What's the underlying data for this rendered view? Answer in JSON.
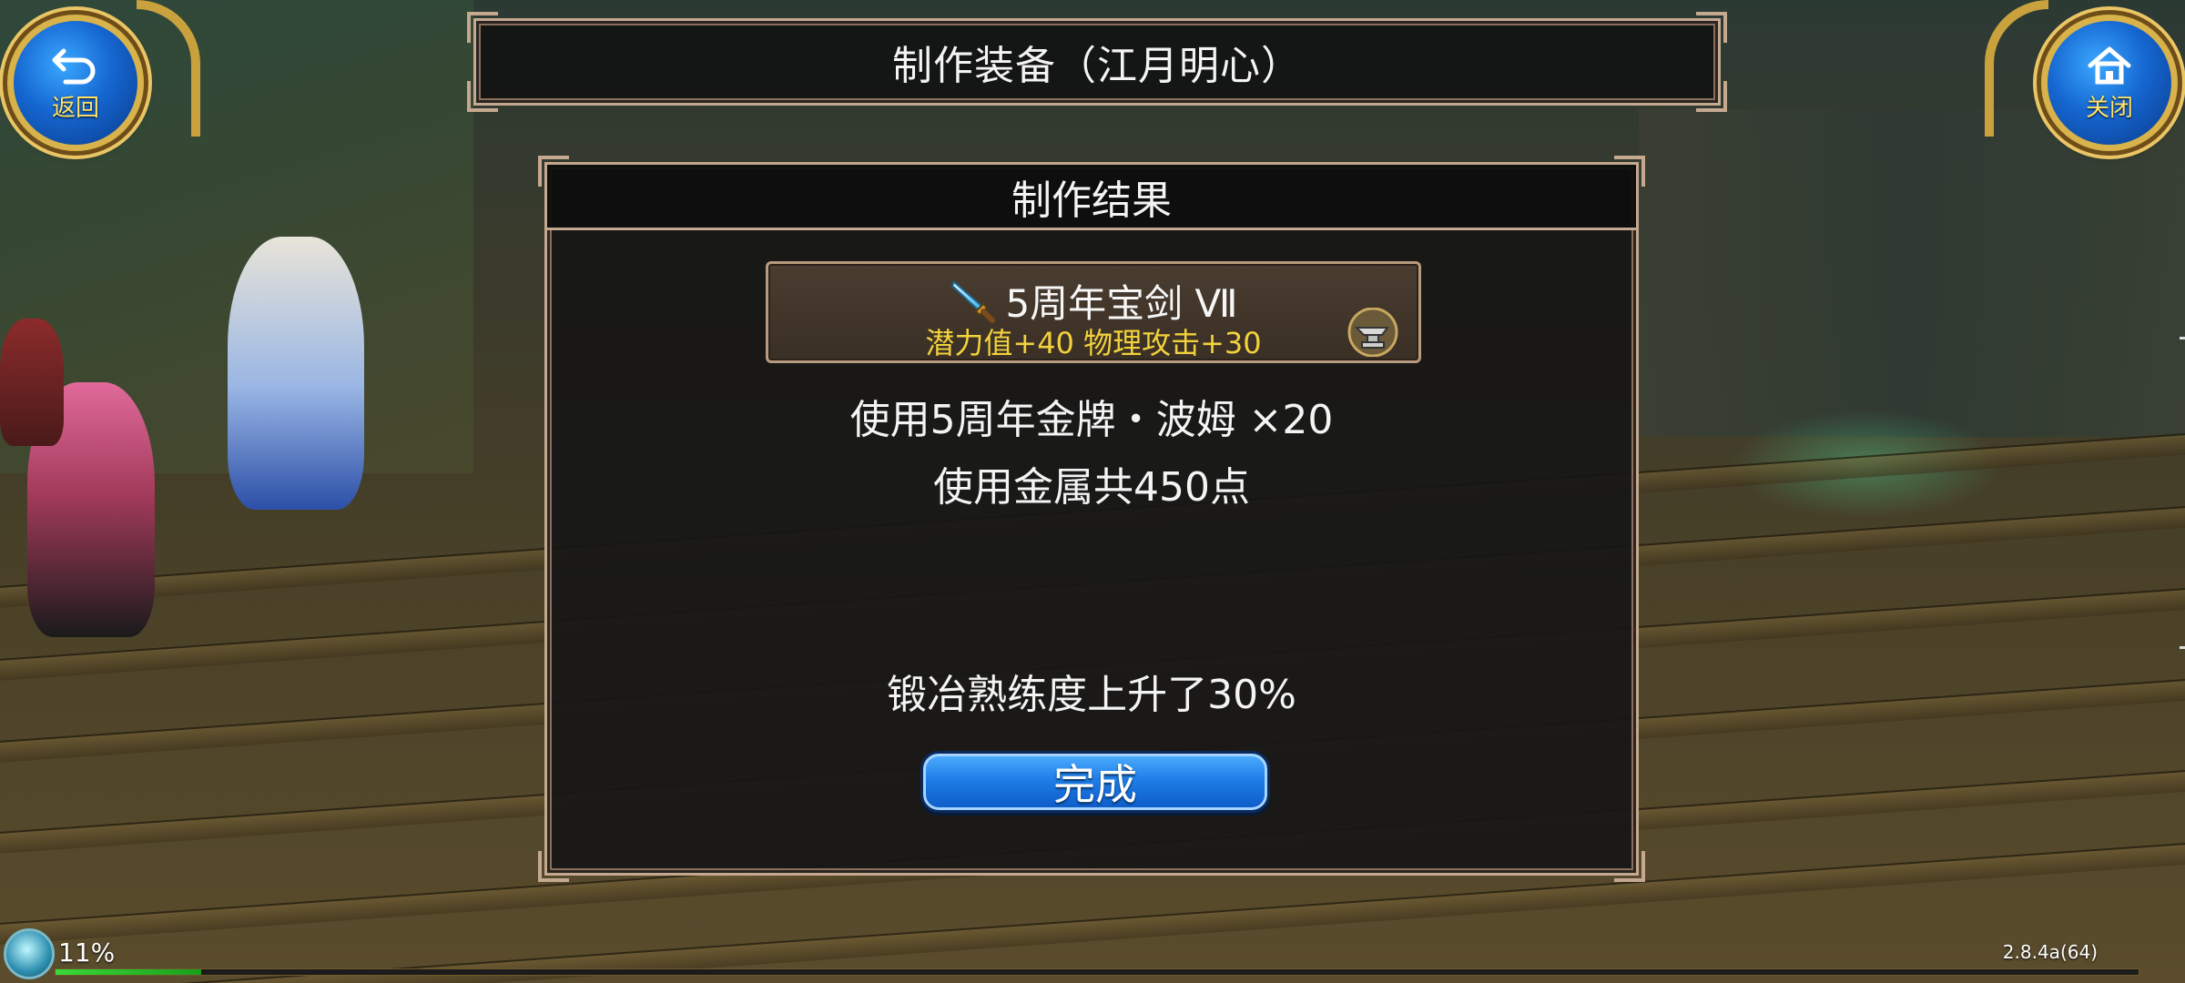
{
  "header": {
    "title": "制作装备（江月明心）"
  },
  "nav": {
    "back_label": "返回",
    "close_label": "关闭"
  },
  "panel": {
    "title": "制作结果",
    "item": {
      "name": "5周年宝剑 Ⅶ",
      "stats": "潜力值+40 物理攻击+30",
      "icon": "sword-icon",
      "side_icon": "anvil-icon"
    },
    "material_line": "使用5周年金牌・波姆 ×20",
    "metal_line": "使用金属共450点",
    "proficiency_line": "锻冶熟练度上升了30%",
    "done_label": "完成"
  },
  "hud": {
    "percent": "11%",
    "xp_progress": 0.07,
    "version": "2.8.4a(64)"
  },
  "colors": {
    "frame": "#c4a890",
    "stat_yellow": "#f2d23c",
    "button_blue": "#1f7ee8",
    "round_gold": "#d8b24a"
  }
}
